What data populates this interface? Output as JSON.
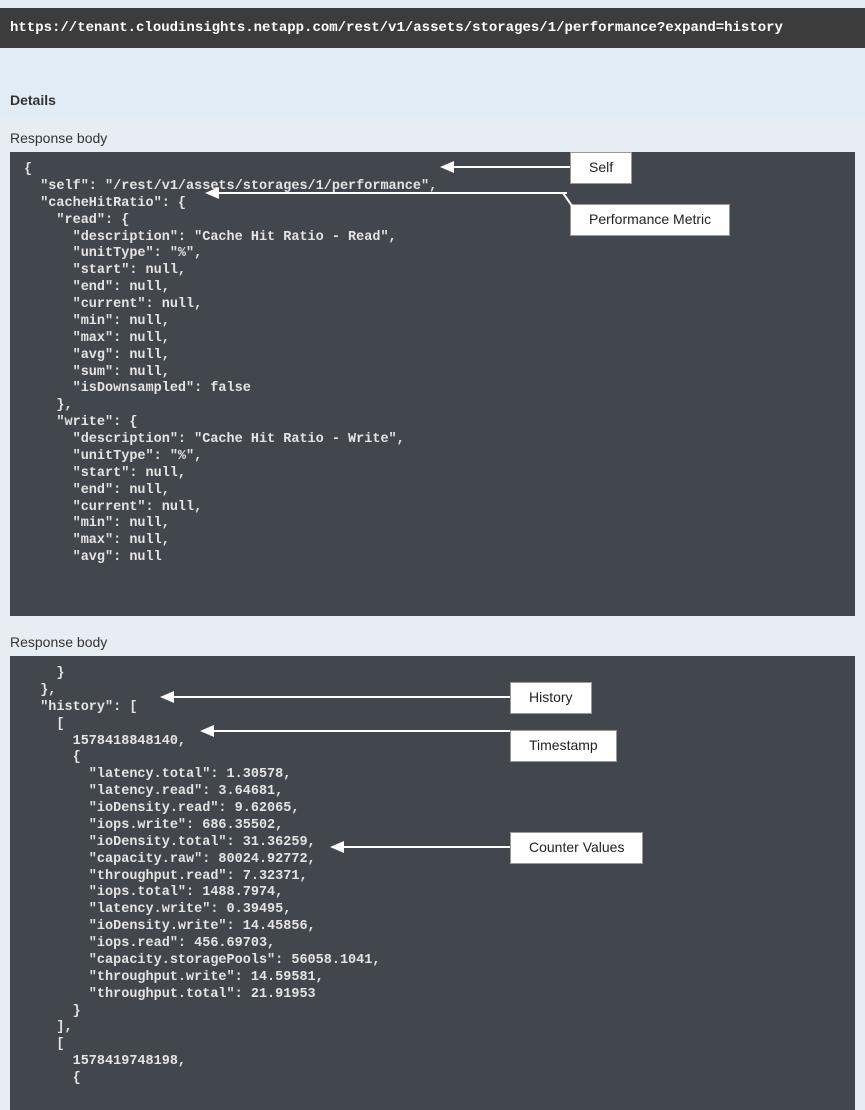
{
  "url": "https://tenant.cloudinsights.netapp.com/rest/v1/assets/storages/1/performance?expand=history",
  "details_label": "Details",
  "response_body_label": "Response body",
  "annotations": {
    "self": "Self",
    "performance_metric": "Performance Metric",
    "history": "History",
    "timestamp": "Timestamp",
    "counter_values": "Counter Values"
  },
  "response1": {
    "self": "/rest/v1/assets/storages/1/performance",
    "cacheHitRatio": {
      "read": {
        "description": "Cache Hit Ratio - Read",
        "unitType": "%",
        "start": null,
        "end": null,
        "current": null,
        "min": null,
        "max": null,
        "avg": null,
        "sum": null,
        "isDownsampled": false
      },
      "write": {
        "description": "Cache Hit Ratio - Write",
        "unitType": "%",
        "start": null,
        "end": null,
        "current": null,
        "min": null,
        "max": null,
        "avg_truncated": "null"
      }
    }
  },
  "response2": {
    "history": [
      {
        "timestamp": 1578418848140,
        "values": {
          "latency.total": 1.30578,
          "latency.read": 3.64681,
          "ioDensity.read": 9.62065,
          "iops.write": 686.35502,
          "ioDensity.total": 31.36259,
          "capacity.raw": 80024.92772,
          "throughput.read": 7.32371,
          "iops.total": 1488.7974,
          "latency.write": 0.39495,
          "ioDensity.write": 14.45856,
          "iops.read": 456.69703,
          "capacity.storagePools": 56058.1041,
          "throughput.write": 14.59581,
          "throughput.total": 21.91953
        }
      },
      {
        "timestamp": 1578419748198
      }
    ]
  },
  "code_block_1": "{\n  \"self\": \"/rest/v1/assets/storages/1/performance\",\n  \"cacheHitRatio\": {\n    \"read\": {\n      \"description\": \"Cache Hit Ratio - Read\",\n      \"unitType\": \"%\",\n      \"start\": null,\n      \"end\": null,\n      \"current\": null,\n      \"min\": null,\n      \"max\": null,\n      \"avg\": null,\n      \"sum\": null,\n      \"isDownsampled\": false\n    },\n    \"write\": {\n      \"description\": \"Cache Hit Ratio - Write\",\n      \"unitType\": \"%\",\n      \"start\": null,\n      \"end\": null,\n      \"current\": null,\n      \"min\": null,\n      \"max\": null,\n      \"avg\": null",
  "code_block_2": "    }\n  },\n  \"history\": [\n    [\n      1578418848140,\n      {\n        \"latency.total\": 1.30578,\n        \"latency.read\": 3.64681,\n        \"ioDensity.read\": 9.62065,\n        \"iops.write\": 686.35502,\n        \"ioDensity.total\": 31.36259,\n        \"capacity.raw\": 80024.92772,\n        \"throughput.read\": 7.32371,\n        \"iops.total\": 1488.7974,\n        \"latency.write\": 0.39495,\n        \"ioDensity.write\": 14.45856,\n        \"iops.read\": 456.69703,\n        \"capacity.storagePools\": 56058.1041,\n        \"throughput.write\": 14.59581,\n        \"throughput.total\": 21.91953\n      }\n    ],\n    [\n      1578419748198,\n      {"
}
